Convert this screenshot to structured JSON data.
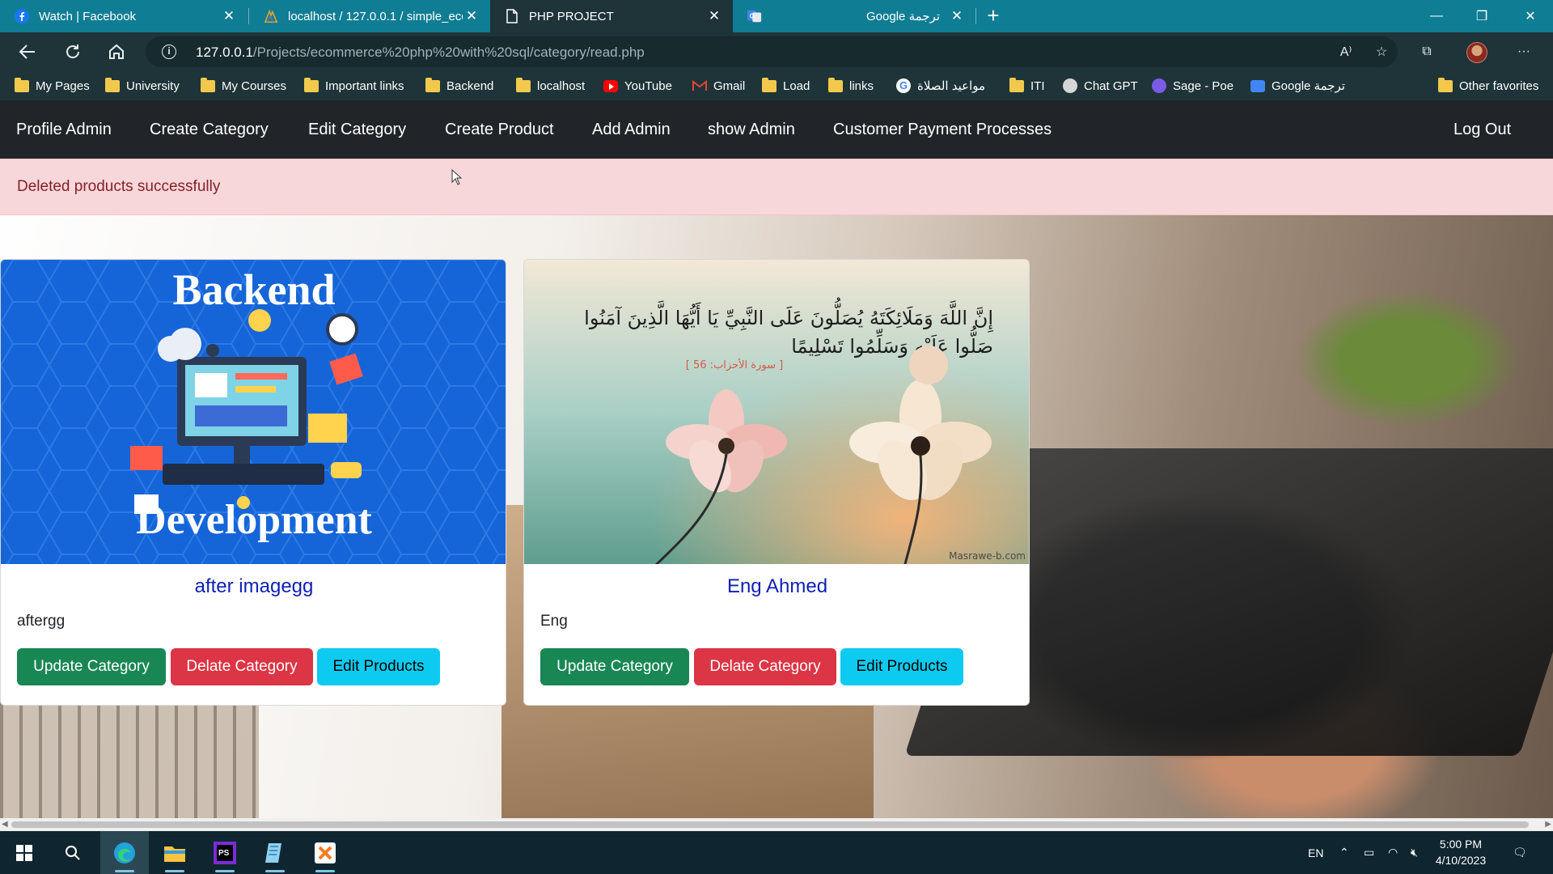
{
  "browser": {
    "tabs": [
      {
        "title": "Watch | Facebook",
        "icon": "facebook-icon"
      },
      {
        "title": "localhost / 127.0.0.1 / simple_ecc",
        "icon": "phpmyadmin-icon"
      },
      {
        "title": "PHP PROJECT",
        "icon": "page-icon",
        "active": true
      },
      {
        "title": "Google ترجمة",
        "icon": "google-translate-icon"
      }
    ],
    "url_host": "127.0.0.1",
    "url_path": "/Projects/ecommerce%20php%20with%20sql/category/read.php",
    "bookmarks": [
      {
        "label": "My Pages",
        "icon": "folder-icon"
      },
      {
        "label": "University",
        "icon": "folder-icon"
      },
      {
        "label": "My Courses",
        "icon": "folder-icon"
      },
      {
        "label": "Important links",
        "icon": "folder-icon"
      },
      {
        "label": "Backend",
        "icon": "folder-icon"
      },
      {
        "label": "localhost",
        "icon": "folder-icon"
      },
      {
        "label": "YouTube",
        "icon": "youtube-icon"
      },
      {
        "label": "Gmail",
        "icon": "gmail-icon"
      },
      {
        "label": "Load",
        "icon": "folder-icon"
      },
      {
        "label": "links",
        "icon": "folder-icon"
      },
      {
        "label": "مواعيد الصلاة",
        "icon": "google-icon"
      },
      {
        "label": "ITI",
        "icon": "folder-icon"
      },
      {
        "label": "Chat GPT",
        "icon": "chatgpt-icon"
      },
      {
        "label": "Sage - Poe",
        "icon": "poe-icon"
      },
      {
        "label": "Google ترجمة",
        "icon": "google-translate-icon"
      },
      {
        "label": "Other favorites",
        "icon": "folder-icon"
      }
    ]
  },
  "nav": {
    "items": [
      "Profile Admin",
      "Create Category",
      "Edit Category",
      "Create Product",
      "Add Admin",
      "show Admin",
      "Customer Payment Processes"
    ],
    "logout": "Log Out"
  },
  "alert": {
    "message": "Deleted products successfully",
    "color": "#f8d7da"
  },
  "cards": [
    {
      "image_title_line1": "Backend",
      "image_title_line2": "Development",
      "title": "after imagegg",
      "text": "aftergg",
      "buttons": {
        "update": "Update Category",
        "delete": "Delate Category",
        "edit": "Edit Products"
      }
    },
    {
      "image_text_1": "إِنَّ اللَّهَ وَمَلَائِكَتَهُ يُصَلُّونَ عَلَى النَّبِيِّ يَا أَيُّهَا الَّذِينَ آمَنُوا",
      "image_text_2": "صَلُّوا عَلَيْهِ وَسَلِّمُوا تَسْلِيمًا",
      "image_text_3": "[ سورة الأحزاب: 56 ]",
      "image_watermark": "Masrawe-b.com",
      "title": "Eng Ahmed",
      "text": "Eng",
      "buttons": {
        "update": "Update Category",
        "delete": "Delate Category",
        "edit": "Edit Products"
      }
    }
  ],
  "colors": {
    "update": "#198754",
    "delete": "#dc3545",
    "edit": "#0dcaf0",
    "navbar": "#212529",
    "tabbar": "#0f7d94"
  },
  "taskbar": {
    "apps": [
      "windows-start-icon",
      "search-icon",
      "edge-icon",
      "file-explorer-icon",
      "phpstorm-icon",
      "notepad-icon",
      "xampp-icon"
    ],
    "lang": "EN",
    "time": "5:00 PM",
    "date": "4/10/2023"
  }
}
